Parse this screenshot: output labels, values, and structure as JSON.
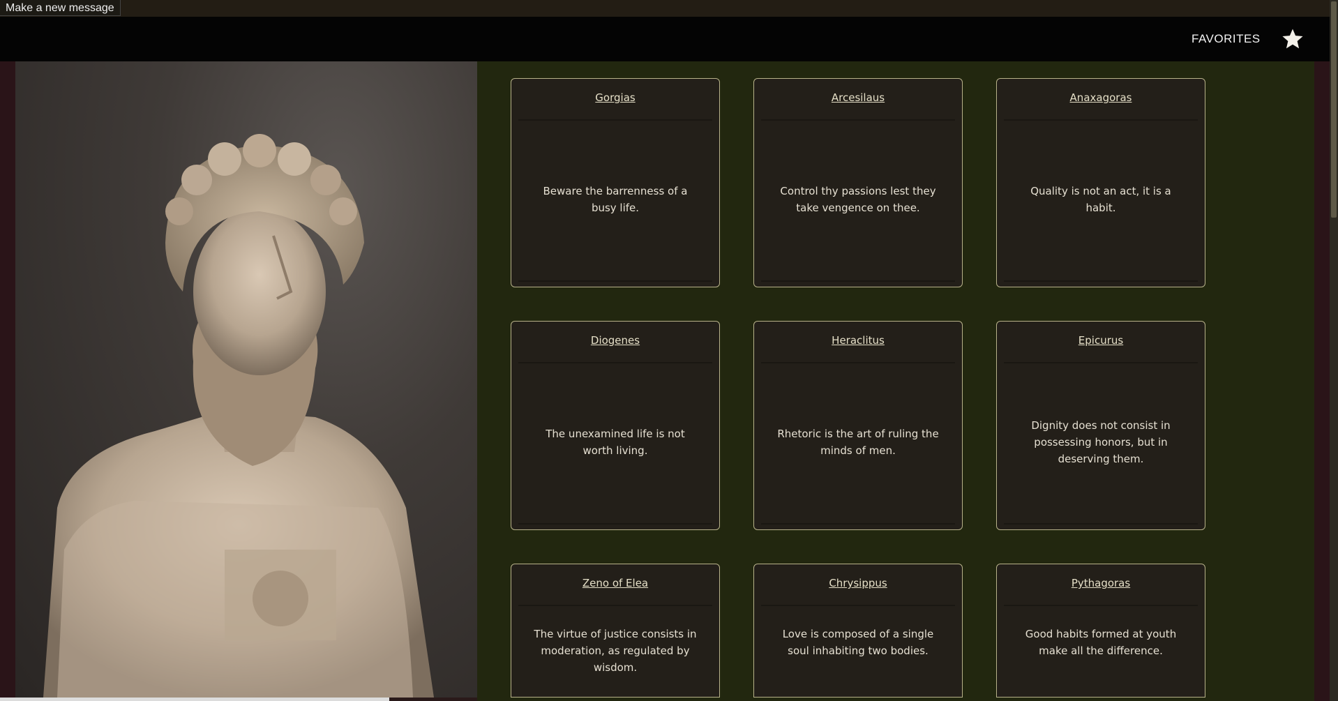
{
  "topbar": {
    "new_message_label": "Make a new message"
  },
  "nav": {
    "favorites_label": "FAVORITES",
    "star_icon": "star-icon"
  },
  "hero": {
    "subject": "marble bust",
    "icon": "bust-image"
  },
  "quotes": [
    {
      "author": "Gorgias",
      "text": "Beware the barrenness of a busy life."
    },
    {
      "author": "Arcesilaus",
      "text": "Control thy passions lest they take vengence on thee."
    },
    {
      "author": "Anaxagoras",
      "text": "Quality is not an act, it is a habit."
    },
    {
      "author": "Diogenes",
      "text": "The unexamined life is not worth living."
    },
    {
      "author": "Heraclitus",
      "text": "Rhetoric is the art of ruling the minds of men."
    },
    {
      "author": "Epicurus",
      "text": "Dignity does not consist in possessing honors, but in deserving them."
    },
    {
      "author": "Zeno of Elea",
      "text": "The virtue of justice consists in moderation, as regulated by wisdom."
    },
    {
      "author": "Chrysippus",
      "text": "Love is composed of a single soul inhabiting two bodies."
    },
    {
      "author": "Pythagoras",
      "text": "Good habits formed at youth make all the difference."
    }
  ],
  "colors": {
    "content_bg": "#22270f",
    "card_bg": "#231f19",
    "card_border": "#b8b28a",
    "nav_bg": "#040404"
  }
}
